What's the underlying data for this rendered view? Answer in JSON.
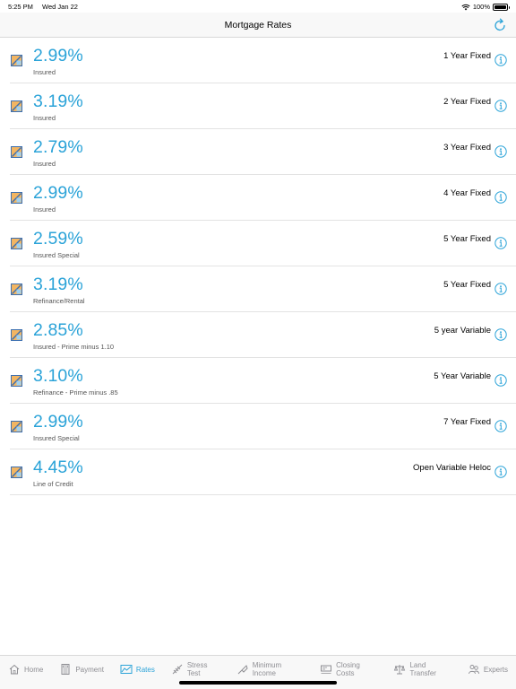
{
  "status_bar": {
    "time": "5:25 PM",
    "date": "Wed Jan 22",
    "battery": "100%"
  },
  "header": {
    "title": "Mortgage Rates",
    "refresh_icon": "refresh-icon"
  },
  "rates": [
    {
      "rate": "2.99%",
      "type": "Insured",
      "term": "1 Year Fixed"
    },
    {
      "rate": "3.19%",
      "type": "Insured",
      "term": "2 Year Fixed"
    },
    {
      "rate": "2.79%",
      "type": "Insured",
      "term": "3 Year Fixed"
    },
    {
      "rate": "2.99%",
      "type": "Insured",
      "term": "4 Year Fixed"
    },
    {
      "rate": "2.59%",
      "type": "Insured Special",
      "term": "5 Year Fixed"
    },
    {
      "rate": "3.19%",
      "type": "Refinance/Rental",
      "term": "5 Year Fixed"
    },
    {
      "rate": "2.85%",
      "type": "Insured - Prime minus 1.10",
      "term": "5 year Variable"
    },
    {
      "rate": "3.10%",
      "type": "Refinance - Prime minus .85",
      "term": "5 Year Variable"
    },
    {
      "rate": "2.99%",
      "type": "Insured Special",
      "term": "7 Year Fixed"
    },
    {
      "rate": "4.45%",
      "type": "Line of Credit",
      "term": "Open Variable Heloc"
    }
  ],
  "tab_bar": {
    "tabs": [
      {
        "label": "Home",
        "icon": "home-icon"
      },
      {
        "label": "Payment",
        "icon": "calculator-icon"
      },
      {
        "label": "Rates",
        "icon": "chart-icon",
        "active": true
      },
      {
        "label": "Stress Test",
        "icon": "stress-test-icon"
      },
      {
        "label": "Minimum Income",
        "icon": "income-icon"
      },
      {
        "label": "Closing Costs",
        "icon": "cash-register-icon"
      },
      {
        "label": "Land Transfer",
        "icon": "scales-icon"
      },
      {
        "label": "Experts",
        "icon": "people-icon"
      }
    ]
  },
  "colors": {
    "accent": "#2ba3d8",
    "inactive_tab": "#8e8e93",
    "nav_background": "#f8f8f8"
  }
}
